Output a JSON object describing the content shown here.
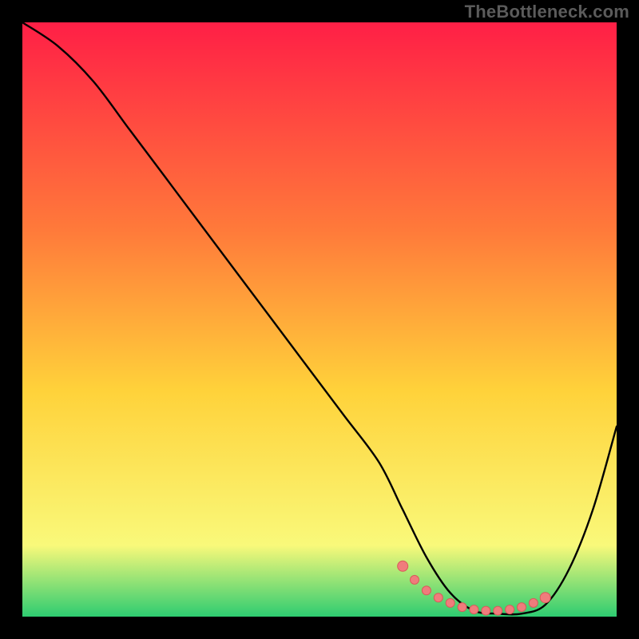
{
  "watermark": "TheBottleneck.com",
  "chart_data": {
    "type": "line",
    "title": "",
    "xlabel": "",
    "ylabel": "",
    "xlim": [
      0,
      100
    ],
    "ylim": [
      0,
      100
    ],
    "grid": false,
    "legend": false,
    "colors": {
      "gradient_top": "#ff1f46",
      "gradient_mid_upper": "#ff7a3a",
      "gradient_mid": "#ffd23a",
      "gradient_lower": "#f9f97a",
      "gradient_bottom": "#2ecc71",
      "curve": "#000000",
      "marker_fill": "#f07c7c",
      "marker_stroke": "#d95a5a"
    },
    "series": [
      {
        "name": "bottleneck-curve",
        "x": [
          0,
          6,
          12,
          18,
          24,
          30,
          36,
          42,
          48,
          54,
          60,
          64,
          68,
          72,
          76,
          80,
          84,
          88,
          92,
          96,
          100
        ],
        "values": [
          100,
          96,
          90,
          82,
          74,
          66,
          58,
          50,
          42,
          34,
          26,
          18,
          10,
          4,
          1,
          0.5,
          0.5,
          2,
          8,
          18,
          32
        ]
      }
    ],
    "markers": {
      "name": "optimal-zone-points",
      "x": [
        64,
        66,
        68,
        70,
        72,
        74,
        76,
        78,
        80,
        82,
        84,
        86,
        88
      ],
      "values": [
        8.5,
        6.2,
        4.4,
        3.2,
        2.3,
        1.6,
        1.2,
        1.0,
        1.0,
        1.2,
        1.6,
        2.3,
        3.2
      ]
    }
  }
}
